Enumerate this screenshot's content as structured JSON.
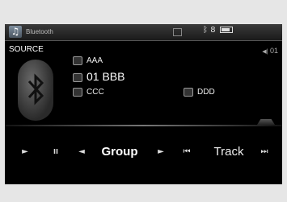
{
  "status": {
    "source_name": "Bluetooth"
  },
  "source": {
    "label": "SOURCE",
    "track_number": "01"
  },
  "info": {
    "line1": "AAA",
    "line2": "01 BBB",
    "line3": "CCC",
    "line4": "DDD"
  },
  "controls": {
    "play": "►",
    "pause": "II",
    "group_prev": "◄",
    "group_label": "Group",
    "group_next": "►",
    "track_prev": "⏮",
    "track_label": "Track",
    "track_next": "⏭"
  },
  "icons": [
    "music-note-icon",
    "phone-icon",
    "bluetooth-icon",
    "battery-icon"
  ]
}
